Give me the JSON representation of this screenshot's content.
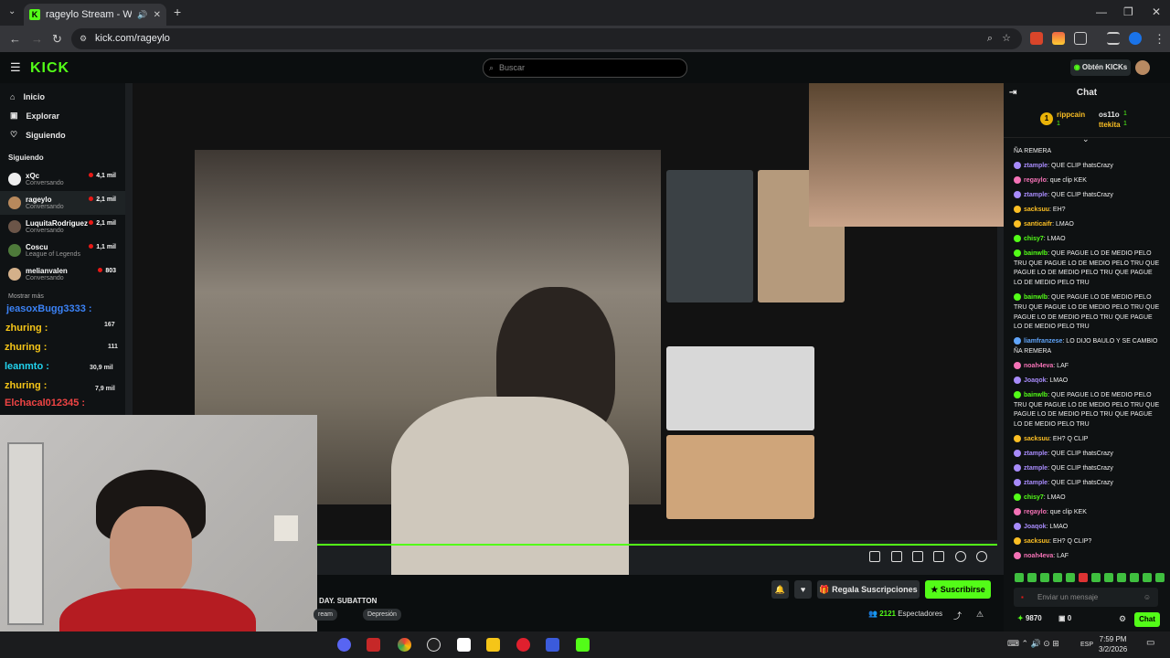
{
  "browser": {
    "tab_title": "rageylo Stream - Watch Live",
    "url": "kick.com/rageylo",
    "new_tab": "+"
  },
  "kick": {
    "logo": "KICK",
    "search_placeholder": "Buscar",
    "obtain": "Obtén KICKs"
  },
  "sidebar": {
    "nav": [
      {
        "label": "Inicio",
        "icon": "home-icon"
      },
      {
        "label": "Explorar",
        "icon": "explore-icon"
      },
      {
        "label": "Siguiendo",
        "icon": "heart-icon"
      }
    ],
    "section": "Siguiendo",
    "following": [
      {
        "name": "xQc",
        "sub": "Conversando",
        "count": "4,1 mil"
      },
      {
        "name": "rageylo",
        "sub": "Conversando",
        "count": "2,1 mil"
      },
      {
        "name": "LuquitaRodriguez",
        "sub": "Conversando",
        "count": "2,1 mil"
      },
      {
        "name": "Coscu",
        "sub": "League of Legends",
        "count": "1,1 mil"
      },
      {
        "name": "melianvalen",
        "sub": "Conversando",
        "count": "803"
      }
    ],
    "more": "Mostrar más",
    "obscured_counts": [
      "167",
      "111",
      "30,9 mil",
      "7,9 mil"
    ]
  },
  "overlay_users": [
    {
      "name": "jeasoxBugg3333 :",
      "color": "#3b82f6"
    },
    {
      "name": "zhuring :",
      "color": "#f5c518"
    },
    {
      "name": "zhuring :",
      "color": "#f5c518"
    },
    {
      "name": "leanmto :",
      "color": "#22d3ee"
    },
    {
      "name": "zhuring :",
      "color": "#f5c518"
    },
    {
      "name": "Elchacal012345 :",
      "color": "#ef4444"
    }
  ],
  "stream": {
    "title_fragment": "DAY. SUBATTON",
    "tags": [
      "ream",
      "Depresión"
    ],
    "gift_label": "Regala Suscripciones",
    "subscribe_label": "Suscribirse",
    "viewers": "2121",
    "viewers_label": "Espectadores"
  },
  "chat": {
    "title": "Chat",
    "pinned": {
      "user1": "rippcain",
      "n1": "1",
      "user2": "os11o",
      "n2": "1",
      "user3": "ttekita",
      "n3": "1"
    },
    "messages": [
      {
        "user": "",
        "color": "#fff",
        "text": "ÑA REMERA"
      },
      {
        "user": "ztample",
        "color": "#a78bfa",
        "text": ": QUE CLIP thatsCrazy"
      },
      {
        "user": "regaylo",
        "color": "#f472b6",
        "text": ": que clip KEK"
      },
      {
        "user": "ztample",
        "color": "#a78bfa",
        "text": ": QUE CLIP thatsCrazy"
      },
      {
        "user": "sacksuu",
        "color": "#fbbf24",
        "text": ": EH?"
      },
      {
        "user": "santicaifr",
        "color": "#fbbf24",
        "text": ": LMAO"
      },
      {
        "user": "chisy7",
        "color": "#53fc18",
        "text": ": LMAO"
      },
      {
        "user": "bainwlb",
        "color": "#53fc18",
        "text": ": QUE PAGUE LO DE MEDIO PELO TRU QUE PAGUE LO DE MEDIO PELO TRU QUE PAGUE LO DE MEDIO PELO TRU QUE PAGUE LO DE MEDIO PELO TRU"
      },
      {
        "user": "bainwlb",
        "color": "#53fc18",
        "text": ": QUE PAGUE LO DE MEDIO PELO TRU QUE PAGUE LO DE MEDIO PELO TRU QUE PAGUE LO DE MEDIO PELO TRU QUE PAGUE LO DE MEDIO PELO TRU"
      },
      {
        "user": "liamfranzese",
        "color": "#60a5fa",
        "text": ": LO DIJO BAULO Y SE CAMBIO ÑA REMERA"
      },
      {
        "user": "noah4eva",
        "color": "#f472b6",
        "text": ": LAF"
      },
      {
        "user": "Joaqok",
        "color": "#a78bfa",
        "text": ": LMAO"
      },
      {
        "user": "bainwlb",
        "color": "#53fc18",
        "text": ": QUE PAGUE LO DE MEDIO PELO TRU QUE PAGUE LO DE MEDIO PELO TRU QUE PAGUE LO DE MEDIO PELO TRU QUE PAGUE LO DE MEDIO PELO TRU"
      },
      {
        "user": "sacksuu",
        "color": "#fbbf24",
        "text": ": EH? Q CLIP"
      },
      {
        "user": "ztample",
        "color": "#a78bfa",
        "text": ": QUE CLIP thatsCrazy"
      },
      {
        "user": "ztample",
        "color": "#a78bfa",
        "text": ": QUE CLIP thatsCrazy"
      },
      {
        "user": "ztample",
        "color": "#a78bfa",
        "text": ": QUE CLIP thatsCrazy"
      },
      {
        "user": "chisy7",
        "color": "#53fc18",
        "text": ": LMAO"
      },
      {
        "user": "regaylo",
        "color": "#f472b6",
        "text": ": que clip KEK"
      },
      {
        "user": "Joaqok",
        "color": "#a78bfa",
        "text": ": LMAO"
      },
      {
        "user": "sacksuu",
        "color": "#fbbf24",
        "text": ": EH? Q CLIP?"
      },
      {
        "user": "noah4eva",
        "color": "#f472b6",
        "text": ": LAF"
      }
    ],
    "input_placeholder": "Enviar un mensaje",
    "kicks": "9870",
    "rewards": "0",
    "send": "Chat"
  },
  "taskbar": {
    "lang": "ESP",
    "time": "7:59 PM",
    "date": "3/2/2026"
  },
  "colors": {
    "accent": "#53fc18",
    "bg": "#0b0e0f"
  }
}
